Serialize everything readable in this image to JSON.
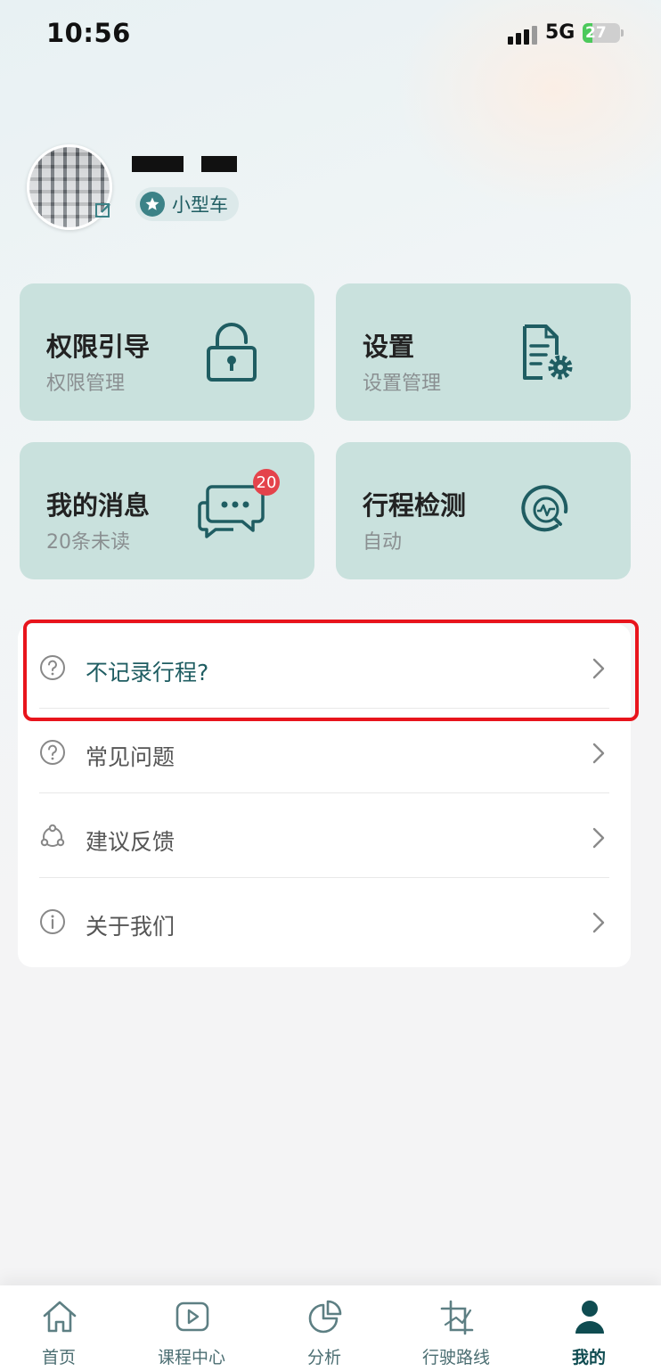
{
  "status_bar": {
    "time": "10:56",
    "network": "5G",
    "battery": "27"
  },
  "profile": {
    "license_badge": "小型车"
  },
  "cards": [
    {
      "title": "权限引导",
      "subtitle": "权限管理",
      "icon": "lock-icon"
    },
    {
      "title": "设置",
      "subtitle": "设置管理",
      "icon": "document-settings-icon"
    },
    {
      "title": "我的消息",
      "subtitle": "20条未读",
      "icon": "chat-bubbles-icon",
      "badge": "20"
    },
    {
      "title": "行程检测",
      "subtitle": "自动",
      "icon": "trip-detect-icon"
    }
  ],
  "list": [
    {
      "label": "不记录行程?",
      "icon": "question-icon"
    },
    {
      "label": "常见问题",
      "icon": "question-icon"
    },
    {
      "label": "建议反馈",
      "icon": "feedback-icon"
    },
    {
      "label": "关于我们",
      "icon": "info-icon"
    }
  ],
  "nav": [
    {
      "label": "首页",
      "icon": "home-icon"
    },
    {
      "label": "课程中心",
      "icon": "play-icon"
    },
    {
      "label": "分析",
      "icon": "pie-chart-icon"
    },
    {
      "label": "行驶路线",
      "icon": "route-icon"
    },
    {
      "label": "我的",
      "icon": "user-icon",
      "active": true
    }
  ],
  "colors": {
    "accent": "#1f5d62",
    "card_bg": "#c9e1dd",
    "highlight": "#e8141c",
    "badge_red": "#e4434b"
  }
}
